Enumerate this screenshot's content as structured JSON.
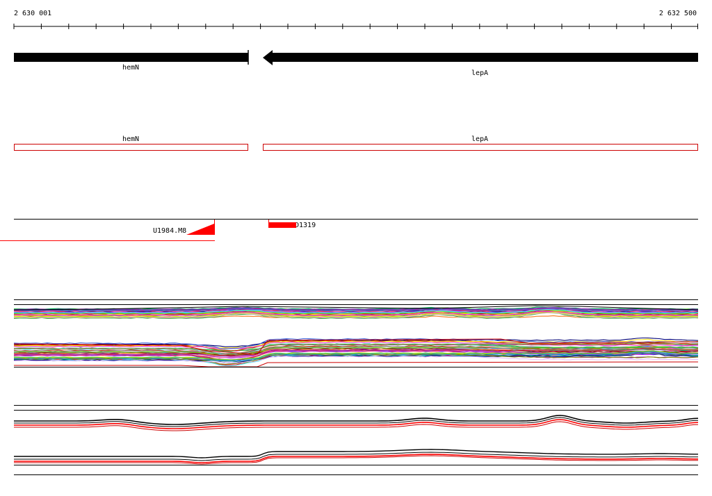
{
  "ruler": {
    "start_label": "2 630 001",
    "end_label": "2 632 500"
  },
  "gene_track": {
    "genes": [
      {
        "name": "hemN",
        "strand": "reverse"
      },
      {
        "name": "lepA",
        "strand": "reverse"
      }
    ]
  },
  "cds_track": {
    "features": [
      {
        "name": "hemN"
      },
      {
        "name": "lepA"
      }
    ]
  },
  "feature_track": {
    "features": [
      {
        "name": "U1984.M8"
      },
      {
        "name": "D1319"
      }
    ]
  },
  "colors": {
    "gene": "#000000",
    "cds_outline": "#cc0000",
    "feature": "#ff0000",
    "axis": "#000000"
  }
}
